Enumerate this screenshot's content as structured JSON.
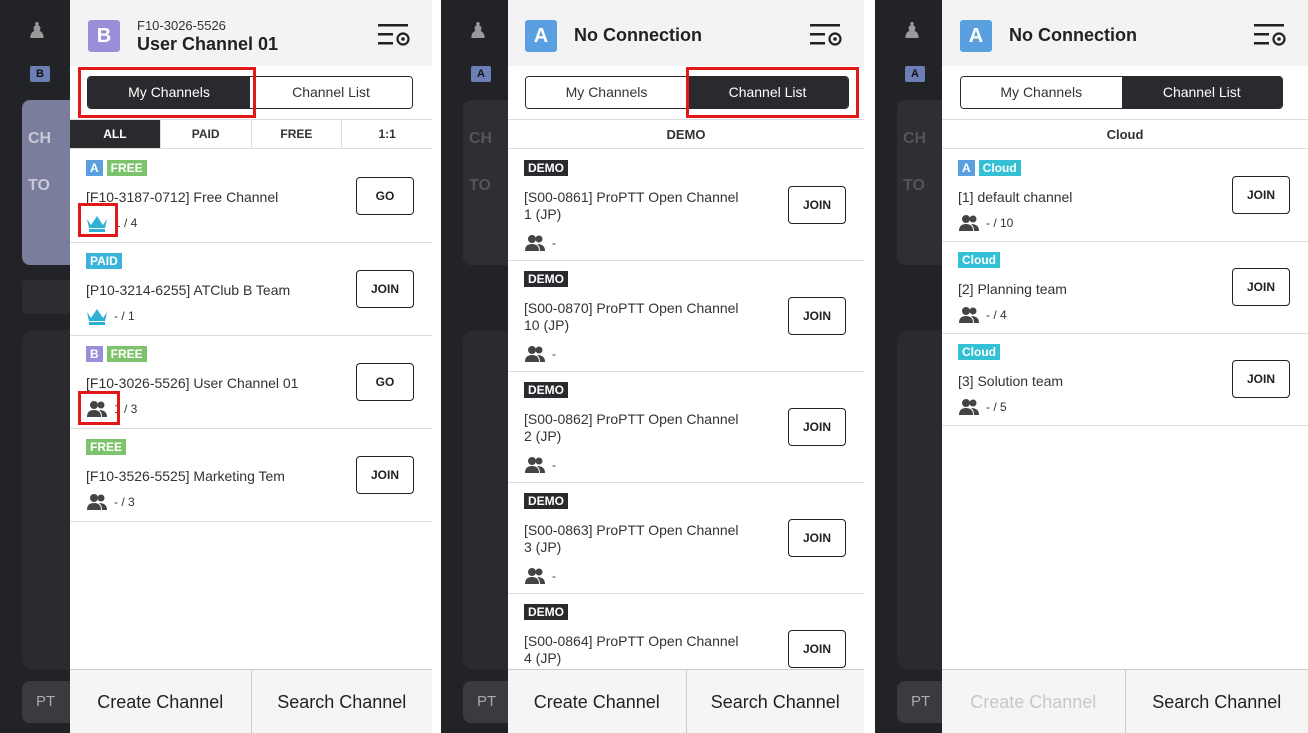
{
  "colors": {
    "badge_a": "#5aa0e0",
    "badge_b": "#9b8ed8",
    "free": "#7dc36b",
    "paid": "#3cb3d8",
    "cloud": "#33bfd4",
    "demo": "#2a2a2e",
    "highlight": "#e01818"
  },
  "background": {
    "ptt_label": "PT",
    "card_text_1": "CH",
    "card_text_2": "TO"
  },
  "screens": [
    {
      "header": {
        "badge": "B",
        "id": "F10-3026-5526",
        "title": "User Channel 01"
      },
      "tabs": [
        "My Channels",
        "Channel List"
      ],
      "filters": [
        "ALL",
        "PAID",
        "FREE",
        "1:1"
      ],
      "rows": [
        {
          "tags": [
            "A",
            "FREE"
          ],
          "name": "[F10-3187-0712]  Free Channel",
          "members": "1 / 4",
          "icon": "crown-icon",
          "button": "GO"
        },
        {
          "tags": [
            "PAID"
          ],
          "name": "[P10-3214-6255]  ATClub B Team",
          "members": "- / 1",
          "icon": "crown-icon",
          "button": "JOIN"
        },
        {
          "tags": [
            "B",
            "FREE"
          ],
          "name": "[F10-3026-5526] User Channel 01",
          "members": "1 / 3",
          "icon": "users-icon",
          "button": "GO"
        },
        {
          "tags": [
            "FREE"
          ],
          "name": "[F10-3526-5525]  Marketing Tem",
          "members": "- / 3",
          "icon": "users-icon",
          "button": "JOIN"
        }
      ],
      "footer": [
        "Create Channel",
        "Search Channel"
      ]
    },
    {
      "header": {
        "badge": "A",
        "title": "No Connection"
      },
      "tabs": [
        "My Channels",
        "Channel List"
      ],
      "section": "DEMO",
      "rows": [
        {
          "tag": "DEMO",
          "name_1": "[S00-0861] ProPTT Open Channel",
          "name_2": "1 (JP)",
          "members": "-",
          "button": "JOIN"
        },
        {
          "tag": "DEMO",
          "name_1": "[S00-0870] ProPTT Open Channel",
          "name_2": "10 (JP)",
          "members": "-",
          "button": "JOIN"
        },
        {
          "tag": "DEMO",
          "name_1": "[S00-0862] ProPTT Open Channel",
          "name_2": "2 (JP)",
          "members": "-",
          "button": "JOIN"
        },
        {
          "tag": "DEMO",
          "name_1": "[S00-0863] ProPTT Open Channel",
          "name_2": "3 (JP)",
          "members": "-",
          "button": "JOIN"
        },
        {
          "tag": "DEMO",
          "name_1": "[S00-0864] ProPTT Open Channel",
          "name_2": "4 (JP)",
          "members": "-",
          "button": "JOIN"
        }
      ],
      "footer": [
        "Create Channel",
        "Search Channel"
      ]
    },
    {
      "header": {
        "badge": "A",
        "title": "No Connection"
      },
      "tabs": [
        "My Channels",
        "Channel List"
      ],
      "section": "Cloud",
      "rows": [
        {
          "tags": [
            "A",
            "Cloud"
          ],
          "name": "[1] default channel",
          "members": "- / 10",
          "button": "JOIN"
        },
        {
          "tags": [
            "Cloud"
          ],
          "name": "[2] Planning team",
          "members": "- / 4",
          "button": "JOIN"
        },
        {
          "tags": [
            "Cloud"
          ],
          "name": "[3] Solution team",
          "members": "- / 5",
          "button": "JOIN"
        }
      ],
      "footer": [
        "Create Channel",
        "Search Channel"
      ]
    }
  ]
}
